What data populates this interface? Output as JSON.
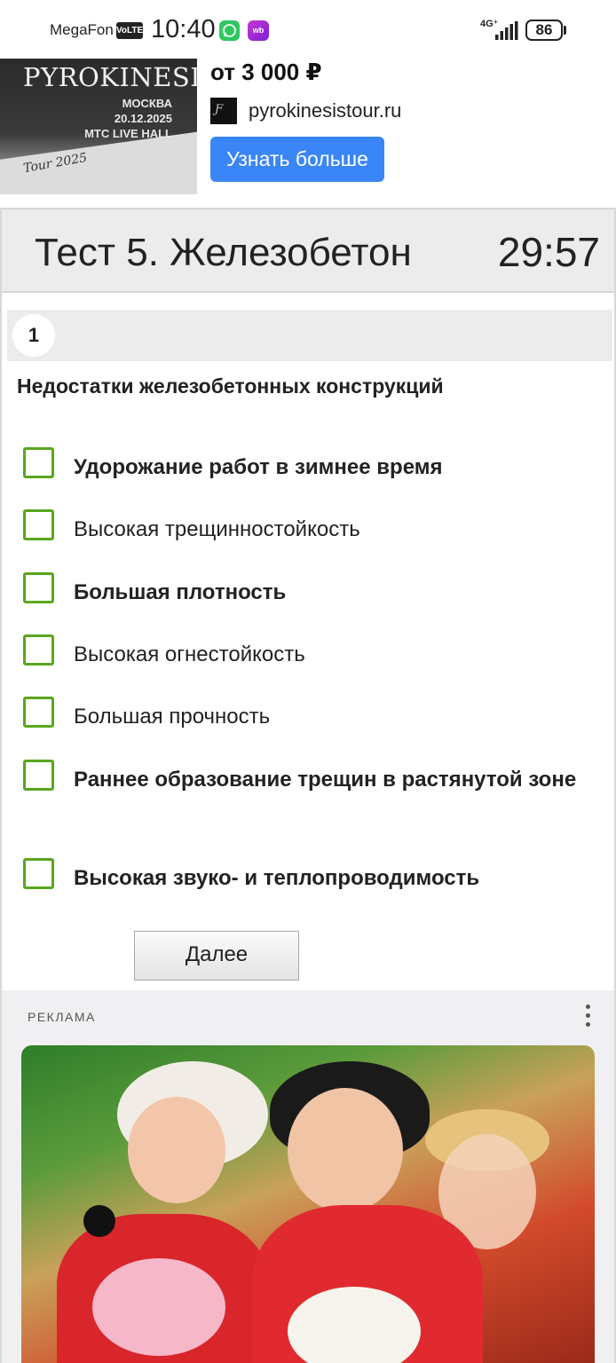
{
  "status_bar": {
    "carrier": "MegaFon",
    "volte": "VoLTE",
    "time": "10:40",
    "wb": "wb",
    "network": "4G⁺",
    "battery": "86"
  },
  "top_ad": {
    "poster": {
      "title": "PYROKINESIS",
      "city": "МОСКВА",
      "date": "20.12.2025",
      "venue": "MTC LIVE HALL",
      "signature": "Tour 2025"
    },
    "price": "от 3 000 ₽",
    "domain": "pyrokinesistour.ru",
    "button": "Узнать больше",
    "accent_color": "#3a86f6"
  },
  "test": {
    "title": "Тест 5. Железобетон",
    "timer": "29:57",
    "question_number": "1",
    "question": "Недостатки железобетонных конструкций",
    "options": [
      {
        "label": "Удорожание работ в зимнее время",
        "checked": false
      },
      {
        "label": "Высокая трещинностойкость",
        "checked": false
      },
      {
        "label": "Большая плотность",
        "checked": false
      },
      {
        "label": "Высокая огнестойкость",
        "checked": false
      },
      {
        "label": "Большая прочность",
        "checked": false
      },
      {
        "label": "Раннее образование трещин в растянутой зоне",
        "checked": false
      },
      {
        "label": "Высокая звуко- и теплопроводимость",
        "checked": false
      }
    ],
    "next_button": "Далее",
    "checkbox_color": "#5aa61e"
  },
  "bottom_ad": {
    "label": "РЕКЛАМА",
    "menu_icon": "more-vertical-icon"
  }
}
